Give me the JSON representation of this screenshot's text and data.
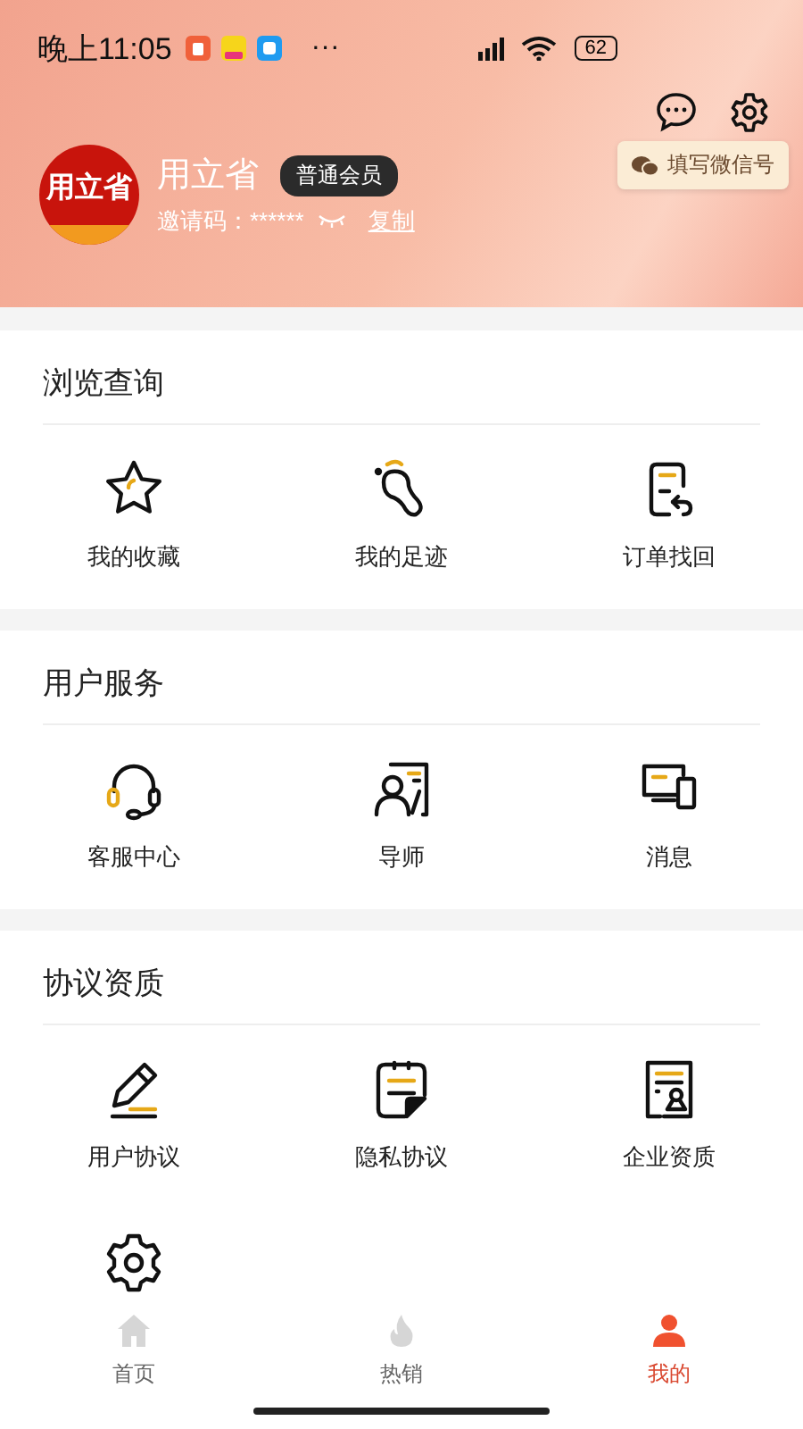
{
  "status_bar": {
    "time": "晚上11:05",
    "more": "···",
    "battery": "62"
  },
  "profile": {
    "avatar_text": "用立省",
    "name": "用立省",
    "badge": "普通会员",
    "invite_label": "邀请码：******",
    "copy": "复制",
    "wechat_tip": "填写微信号"
  },
  "sections": [
    {
      "title": "浏览查询",
      "items": [
        {
          "kind": "star",
          "label": "我的收藏"
        },
        {
          "kind": "footprint",
          "label": "我的足迹"
        },
        {
          "kind": "document",
          "label": "订单找回"
        }
      ]
    },
    {
      "title": "用户服务",
      "items": [
        {
          "kind": "headset",
          "label": "客服中心"
        },
        {
          "kind": "teacher",
          "label": "导师"
        },
        {
          "kind": "devices",
          "label": "消息"
        }
      ]
    },
    {
      "title": "协议资质",
      "items": [
        {
          "kind": "pen",
          "label": "用户协议"
        },
        {
          "kind": "notepad",
          "label": "隐私协议"
        },
        {
          "kind": "certificate",
          "label": "企业资质"
        },
        {
          "kind": "gear"
        }
      ]
    }
  ],
  "tabs": [
    {
      "kind": "home",
      "label": "首页",
      "selected": false
    },
    {
      "kind": "flame",
      "label": "热销",
      "selected": false
    },
    {
      "kind": "person",
      "label": "我的",
      "selected": true
    }
  ]
}
